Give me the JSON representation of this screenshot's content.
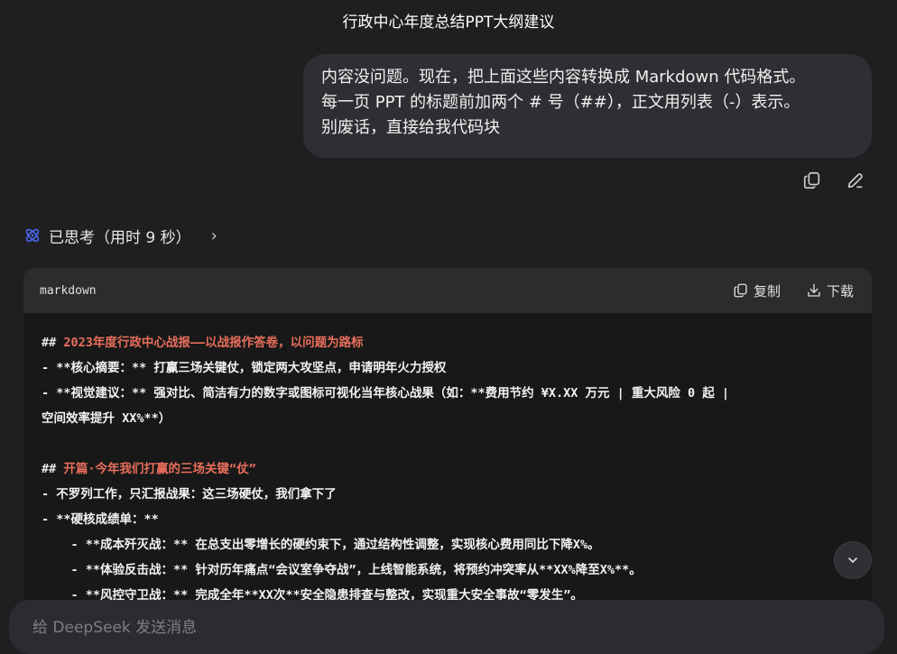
{
  "header": {
    "title": "行政中心年度总结PPT大纲建议"
  },
  "user_message": {
    "lines": [
      "内容没问题。现在，把上面这些内容转换成 Markdown 代码格式。",
      "每一页 PPT 的标题前加两个 # 号（##），正文用列表（-）表示。",
      "别废话，直接给我代码块"
    ],
    "actions": {
      "copy_icon": "copy-icon",
      "edit_icon": "pencil-icon"
    }
  },
  "thinking": {
    "label": "已思考（用时 9 秒）",
    "icon": "atom-icon",
    "chevron": "›"
  },
  "code_block": {
    "language": "markdown",
    "copy_label": "复制",
    "download_label": "下载",
    "lines": [
      {
        "kind": "heading",
        "prefix": "## ",
        "text": "2023年度行政中心战报——以战报作答卷，以问题为路标"
      },
      {
        "kind": "plain",
        "text": "- **核心摘要：** 打赢三场关键仗，锁定两大攻坚点，申请明年火力授权"
      },
      {
        "kind": "plain",
        "text": "- **视觉建议：** 强对比、简洁有力的数字或图标可视化当年核心战果（如：**费用节约 ¥X.XX 万元 | 重大风险 0 起 |"
      },
      {
        "kind": "plain",
        "text": "空间效率提升 XX%**）"
      },
      {
        "kind": "blank",
        "text": ""
      },
      {
        "kind": "heading",
        "prefix": "## ",
        "text": "开篇·今年我们打赢的三场关键“仗”"
      },
      {
        "kind": "plain",
        "text": "- 不罗列工作，只汇报战果：这三场硬仗，我们拿下了"
      },
      {
        "kind": "plain",
        "text": "- **硬核成绩单：**"
      },
      {
        "kind": "plain",
        "text": "    - **成本歼灭战：** 在总支出零增长的硬约束下，通过结构性调整，实现核心费用同比下降X%。"
      },
      {
        "kind": "plain",
        "text": "    - **体验反击战：** 针对历年痛点“会议室争夺战”，上线智能系统，将预约冲突率从**XX%降至X%**。"
      },
      {
        "kind": "plain",
        "text": "    - **风控守卫战：** 完成全年**XX次**安全隐患排查与整改，实现重大安全事故“零发生”。"
      }
    ]
  },
  "scroll_button": {
    "icon": "chevron-down-icon"
  },
  "composer": {
    "placeholder": "给 DeepSeek 发送消息"
  }
}
